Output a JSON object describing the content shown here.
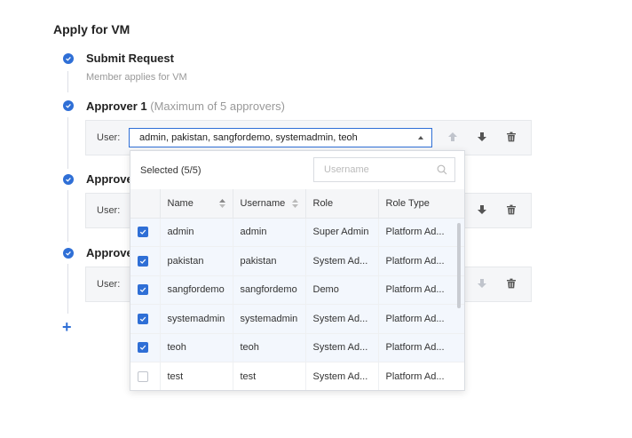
{
  "page": {
    "title": "Apply for VM"
  },
  "steps": [
    {
      "title": "Submit Request",
      "desc": "Member applies for VM"
    },
    {
      "title": "Approver 1",
      "hint": "(Maximum of 5 approvers)"
    },
    {
      "title": "Approver"
    },
    {
      "title": "Approver"
    }
  ],
  "user_label": "User:",
  "approver1_selected": "admin, pakistan, sangfordemo, systemadmin, teoh",
  "dropdown": {
    "selected_count": "Selected (5/5)",
    "search_placeholder": "Username",
    "columns": [
      "Name",
      "Username",
      "Role",
      "Role Type"
    ],
    "rows": [
      {
        "name": "admin",
        "username": "admin",
        "role": "Super Admin",
        "role_type": "Platform Ad...",
        "checked": true
      },
      {
        "name": "pakistan",
        "username": "pakistan",
        "role": "System Ad...",
        "role_type": "Platform Ad...",
        "checked": true
      },
      {
        "name": "sangfordemo",
        "username": "sangfordemo",
        "role": "Demo",
        "role_type": "Platform Ad...",
        "checked": true
      },
      {
        "name": "systemadmin",
        "username": "systemadmin",
        "role": "System Ad...",
        "role_type": "Platform Ad...",
        "checked": true
      },
      {
        "name": "teoh",
        "username": "teoh",
        "role": "System Ad...",
        "role_type": "Platform Ad...",
        "checked": true
      },
      {
        "name": "test",
        "username": "test",
        "role": "System Ad...",
        "role_type": "Platform Ad...",
        "checked": false
      }
    ]
  },
  "icons": {
    "step": "check-circle-icon",
    "move_up": "arrow-up-icon",
    "move_down": "arrow-down-icon",
    "delete": "trash-icon",
    "add": "plus-icon",
    "search": "search-icon"
  },
  "colors": {
    "accent": "#2f6fd6",
    "disabled": "#c0c4cc",
    "action": "#555555"
  },
  "add_label": "+"
}
